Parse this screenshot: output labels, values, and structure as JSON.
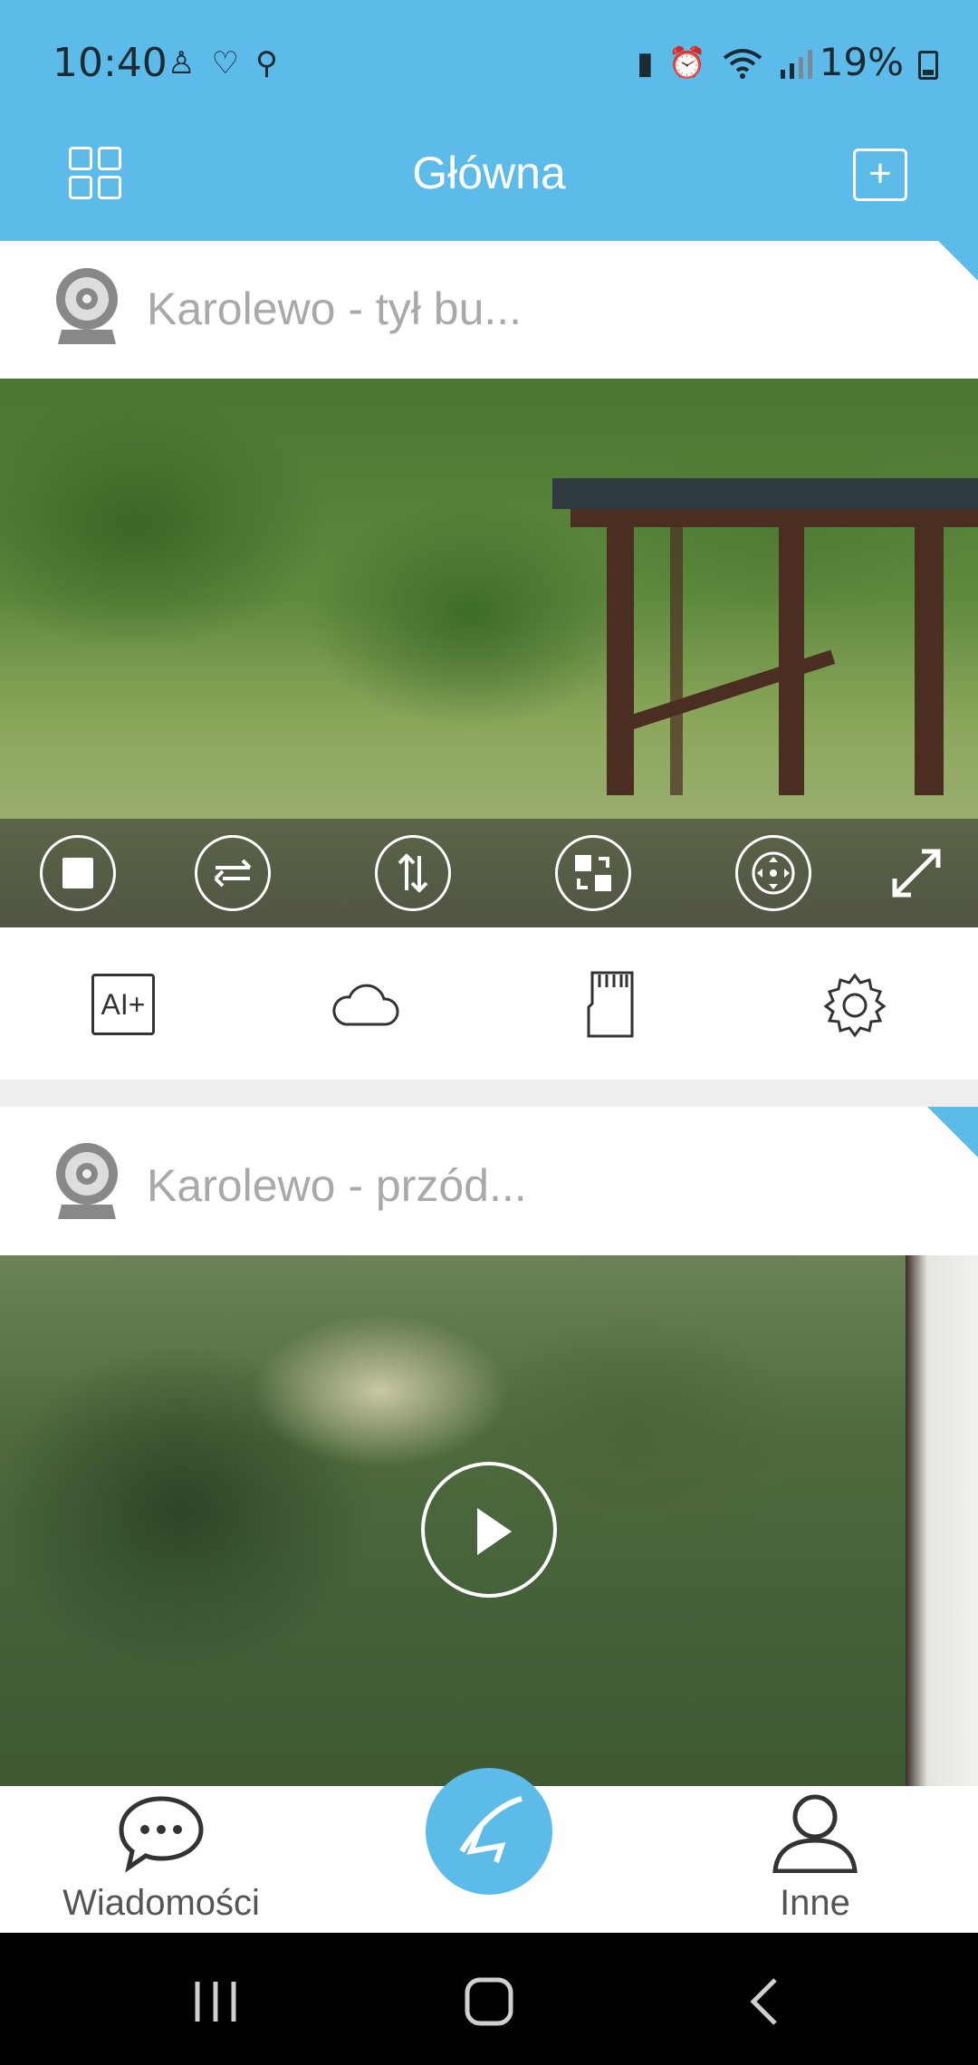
{
  "status_bar": {
    "time": "10:40",
    "battery": "19%",
    "left_icons": [
      "mobile-app-icon",
      "heart-icon",
      "location-icon"
    ],
    "right_icons": [
      "battery-saver-icon",
      "alarm-icon",
      "wifi-icon",
      "signal-icon"
    ]
  },
  "header": {
    "title": "Główna",
    "left_button": "grid-view-icon",
    "right_button": "add-device-icon"
  },
  "cameras": [
    {
      "name": "Karolewo - tył bu...",
      "state": "live",
      "controls": [
        "stop-icon",
        "swap-horizontal-icon",
        "swap-vertical-icon",
        "toggle-view-icon",
        "ptz-icon",
        "fullscreen-icon"
      ]
    },
    {
      "name": "Karolewo - przód...",
      "state": "paused"
    }
  ],
  "card_toolbar": {
    "ai_label": "AI+",
    "items": [
      "ai-plus-icon",
      "cloud-icon",
      "sd-card-icon",
      "settings-icon"
    ]
  },
  "bottom_nav": {
    "messages_label": "Wiadomości",
    "center_icon": "home-logo-icon",
    "other_label": "Inne"
  },
  "colors": {
    "accent": "#5cbbe9",
    "muted_text": "#a9a9a9"
  }
}
